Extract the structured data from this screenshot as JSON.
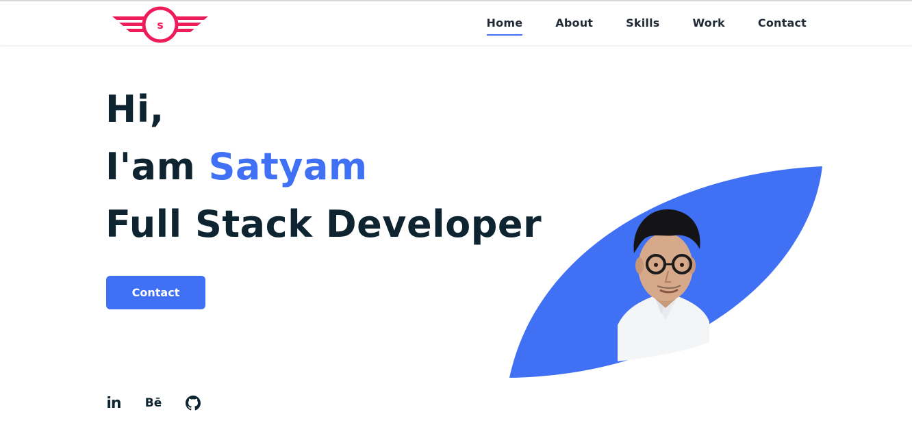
{
  "header": {
    "logo_letter": "s",
    "nav": [
      {
        "label": "Home",
        "active": true
      },
      {
        "label": "About",
        "active": false
      },
      {
        "label": "Skills",
        "active": false
      },
      {
        "label": "Work",
        "active": false
      },
      {
        "label": "Contact",
        "active": false
      }
    ]
  },
  "hero": {
    "greeting": "Hi,",
    "intro_prefix": "I'am ",
    "name": "Satyam",
    "role": "Full Stack Developer",
    "cta_label": "Contact"
  },
  "socials": [
    {
      "name": "linkedin-icon",
      "glyph": "in"
    },
    {
      "name": "behance-icon",
      "glyph": "Bē"
    },
    {
      "name": "github-icon",
      "glyph": ""
    }
  ],
  "colors": {
    "accent": "#4070f4",
    "logo": "#ee1c5a",
    "text": "#0e2431"
  }
}
